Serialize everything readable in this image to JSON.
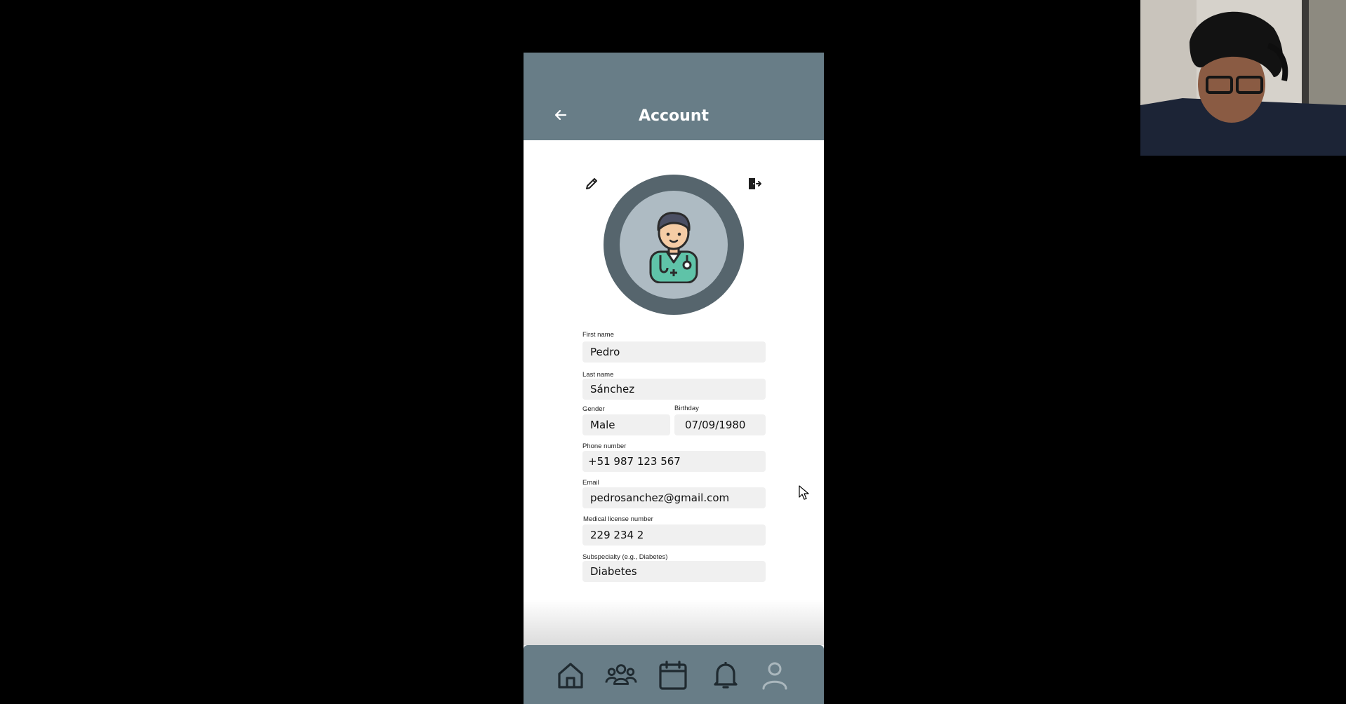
{
  "header": {
    "title": "Account"
  },
  "icons": {
    "back": "arrow-left-icon",
    "edit": "pencil-icon",
    "logout": "door-exit-icon",
    "avatar": "doctor-avatar-icon"
  },
  "form": {
    "first_name": {
      "label": "First name",
      "value": "Pedro"
    },
    "last_name": {
      "label": "Last name",
      "value": "Sánchez"
    },
    "gender": {
      "label": "Gender",
      "value": "Male"
    },
    "birthday": {
      "label": "Birthday",
      "value": "07/09/1980"
    },
    "phone": {
      "label": "Phone number",
      "value": "+51 987 123 567"
    },
    "email": {
      "label": "Email",
      "value": "pedrosanchez@gmail.com"
    },
    "license": {
      "label": "Medical license number",
      "value": "229 234 2"
    },
    "subspecialty": {
      "label": "Subspecialty (e.g., Diabetes)",
      "value": "Diabetes"
    }
  },
  "bottom_nav": [
    "home-icon",
    "patients-icon",
    "calendar-icon",
    "bell-icon",
    "profile-icon"
  ],
  "colors": {
    "appbar": "#687d87",
    "avatar_ring": "#56656d",
    "avatar_fill": "#aebbc3",
    "field_bg": "#f0f0f0",
    "nav_icon": "#1f2a30"
  }
}
